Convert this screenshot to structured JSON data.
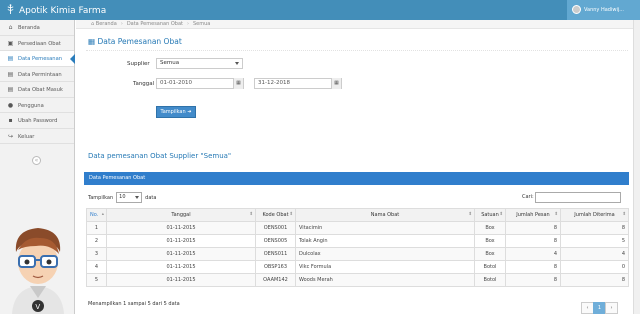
{
  "app": {
    "title": "Apotik Kimia Farma",
    "user_name": "Vanny Hadiwij..."
  },
  "breadcrumb": [
    "Beranda",
    "Data Pemesanan Obat",
    "Semua"
  ],
  "sidebar": {
    "items": [
      {
        "label": "Beranda",
        "icon": "home-icon"
      },
      {
        "label": "Persediaan Obat",
        "icon": "briefcase-icon"
      },
      {
        "label": "Data Pemesanan",
        "icon": "document-icon"
      },
      {
        "label": "Data Permintaan",
        "icon": "document-icon"
      },
      {
        "label": "Data Obat Masuk",
        "icon": "document-icon"
      },
      {
        "label": "Pengguna",
        "icon": "user-icon"
      },
      {
        "label": "Ubah Password",
        "icon": "lock-icon"
      },
      {
        "label": "Keluar",
        "icon": "logout-icon"
      }
    ],
    "active": 2
  },
  "page": {
    "title": "Data Pemesanan Obat",
    "supplier_label": "Supplier",
    "supplier_value": "Semua",
    "date_label": "Tanggal",
    "date_from": "01-01-2010",
    "date_to": "31-12-2018",
    "show_button": "Tampilkan",
    "result_title": "Data pemesanan Obat Supplier \"Semua\""
  },
  "table_panel": {
    "header": "Data Pemesanan Obat",
    "length_prefix": "Tampilkan",
    "length_value": "10",
    "length_suffix": "data",
    "search_label": "Cari:",
    "columns": [
      "No.",
      "Tanggal",
      "Kode Obat",
      "Nama Obat",
      "Satuan",
      "Jumlah Pesan",
      "Jumlah Diterima"
    ],
    "rows": [
      [
        "1",
        "01-11-2015",
        "OENS001",
        "Vitacimin",
        "Box",
        "8",
        "8"
      ],
      [
        "2",
        "01-11-2015",
        "OENS005",
        "Tolak Angin",
        "Box",
        "8",
        "5"
      ],
      [
        "3",
        "01-11-2015",
        "OENS011",
        "Dulcolax",
        "Box",
        "4",
        "4"
      ],
      [
        "4",
        "01-11-2015",
        "OBSP163",
        "Vikc Formula",
        "Botol",
        "8",
        "0"
      ],
      [
        "5",
        "01-11-2015",
        "OAAM142",
        "Woods Merah",
        "Botol",
        "8",
        "8"
      ]
    ],
    "info": "Menampilkan 1 sampai 5 dari 5 data",
    "pager": [
      "‹",
      "1",
      "›"
    ]
  },
  "colors": {
    "navbar": "#438eb9",
    "accent": "#307ecc",
    "title": "#2679b5"
  }
}
